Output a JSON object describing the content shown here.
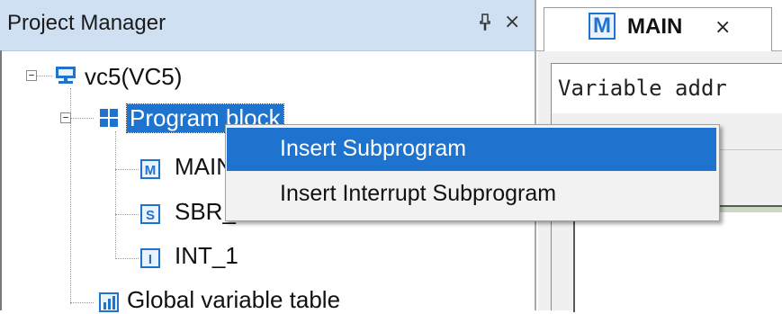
{
  "project_manager": {
    "title": "Project Manager",
    "pin_icon": "pin-icon",
    "close_glyph": "×"
  },
  "tree": {
    "root": {
      "label": "vc5(VC5)",
      "icon": "computer-icon",
      "expander": "⊟"
    },
    "program_block": {
      "label": "Program block",
      "icon": "program-block-icon",
      "expander": "⊟"
    },
    "children": [
      {
        "label": "MAIN",
        "icon_letter": "M"
      },
      {
        "label": "SBR_1",
        "icon_letter": "S"
      },
      {
        "label": "INT_1",
        "icon_letter": "I"
      }
    ],
    "global_var": {
      "label": "Global variable table",
      "icon": "table-icon"
    }
  },
  "tab": {
    "icon_letter": "M",
    "label": "MAIN",
    "close_glyph": "×"
  },
  "editor": {
    "var_text": "Variable addr"
  },
  "context_menu": {
    "items": [
      {
        "label": "Insert Subprogram",
        "highlighted": true
      },
      {
        "label": "Insert Interrupt Subprogram",
        "highlighted": false
      }
    ]
  },
  "colors": {
    "accent": "#1e73cf",
    "header_bg": "#cfe0f3",
    "menu_bg": "#f2f2f2"
  }
}
